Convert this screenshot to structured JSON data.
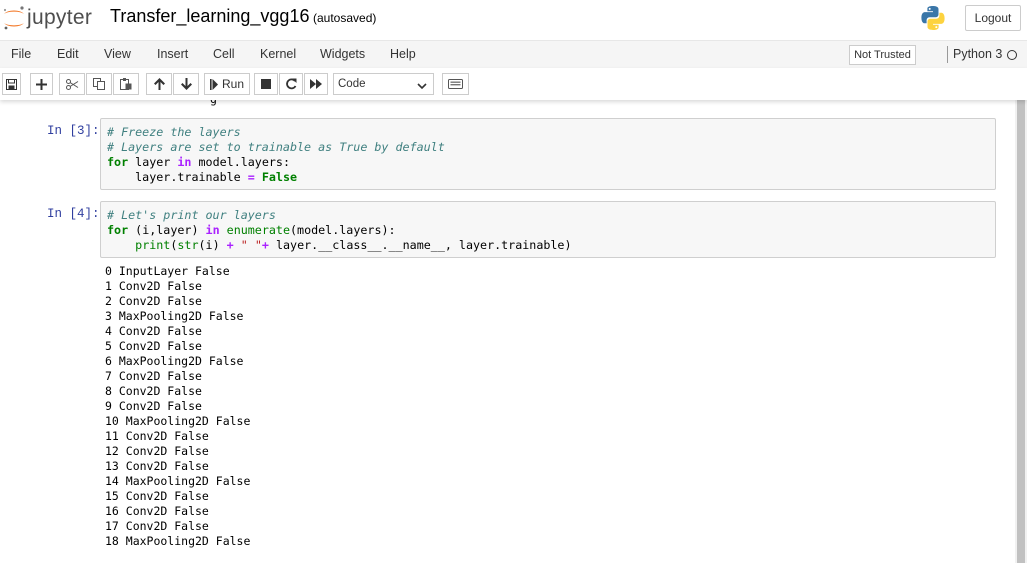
{
  "header": {
    "logo_text": "jupyter",
    "notebook_name": "Transfer_learning_vgg16",
    "save_status": "(autosaved)",
    "logout_label": "Logout"
  },
  "menubar": {
    "items": [
      "File",
      "Edit",
      "View",
      "Insert",
      "Cell",
      "Kernel",
      "Widgets",
      "Help"
    ],
    "trust_label": "Not Trusted",
    "kernel_name": "Python 3"
  },
  "toolbar": {
    "run_label": "Run",
    "cell_type": "Code",
    "icons": [
      "save-icon",
      "add-cell-icon",
      "cut-icon",
      "copy-icon",
      "paste-icon",
      "move-up-icon",
      "move-down-icon",
      "run-icon",
      "stop-icon",
      "restart-icon",
      "fast-forward-icon",
      "keyboard-icon"
    ]
  },
  "cells": [
    {
      "prompt": "In [3]:",
      "lines": [
        "# Freeze the layers",
        "# Layers are set to trainable as True by default",
        "for layer in model.layers:",
        "    layer.trainable = False"
      ]
    },
    {
      "prompt": "In [4]:",
      "lines": [
        "# Let's print our layers",
        "for (i,layer) in enumerate(model.layers):",
        "    print(str(i) + \" \"+ layer.__class__.__name__, layer.trainable)"
      ],
      "output": [
        "0 InputLayer False",
        "1 Conv2D False",
        "2 Conv2D False",
        "3 MaxPooling2D False",
        "4 Conv2D False",
        "5 Conv2D False",
        "6 MaxPooling2D False",
        "7 Conv2D False",
        "8 Conv2D False",
        "9 Conv2D False",
        "10 MaxPooling2D False",
        "11 Conv2D False",
        "12 Conv2D False",
        "13 Conv2D False",
        "14 MaxPooling2D False",
        "15 Conv2D False",
        "16 Conv2D False",
        "17 Conv2D False",
        "18 MaxPooling2D False"
      ]
    }
  ],
  "colors": {
    "prompt": "#303f9f",
    "comment": "#408080",
    "keyword": "#008000",
    "operator": "#aa22ff",
    "string": "#ba2121",
    "jupyter_orange": "#f37726"
  }
}
